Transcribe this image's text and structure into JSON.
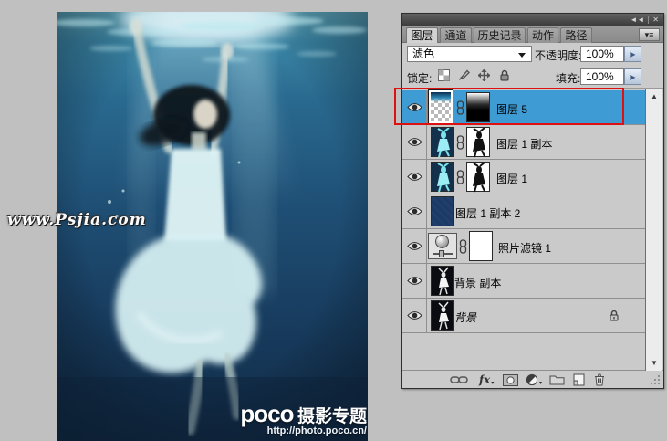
{
  "window": {
    "collapse_glyph": "◄◄",
    "close_glyph": "✕"
  },
  "glyphs": {
    "up": "▲",
    "down": "▼",
    "spin": "▶",
    "menu": "▾≡",
    "fx": "fx",
    "mini_caret": "▾"
  },
  "panel": {
    "tabs": [
      "图层",
      "通道",
      "历史记录",
      "动作",
      "路径"
    ],
    "blend_mode_value": "滤色",
    "opacity_label": "不透明度:",
    "opacity_value": "100%",
    "lock_label": "锁定:",
    "fill_label": "填充:",
    "fill_value": "100%",
    "layers": [
      {
        "name": "图层 5",
        "selected": true,
        "highlighted": true
      },
      {
        "name": "图层 1 副本"
      },
      {
        "name": "图层 1"
      },
      {
        "name": "图层 1 副本 2"
      },
      {
        "name": "照片滤镜 1"
      },
      {
        "name": "背景 副本"
      },
      {
        "name": "背景",
        "locked": true
      }
    ]
  },
  "photo": {
    "watermark": "www.Psjia.com",
    "brand": "poco",
    "brand_suffix": "摄影专题",
    "brand_url": "http://photo.poco.cn/"
  },
  "colors": {
    "selection_blue": "#3f9bd3",
    "highlight_red": "#dd1111",
    "panel_bg": "#cbcbcb",
    "workspace_bg": "#c0c0c0"
  }
}
